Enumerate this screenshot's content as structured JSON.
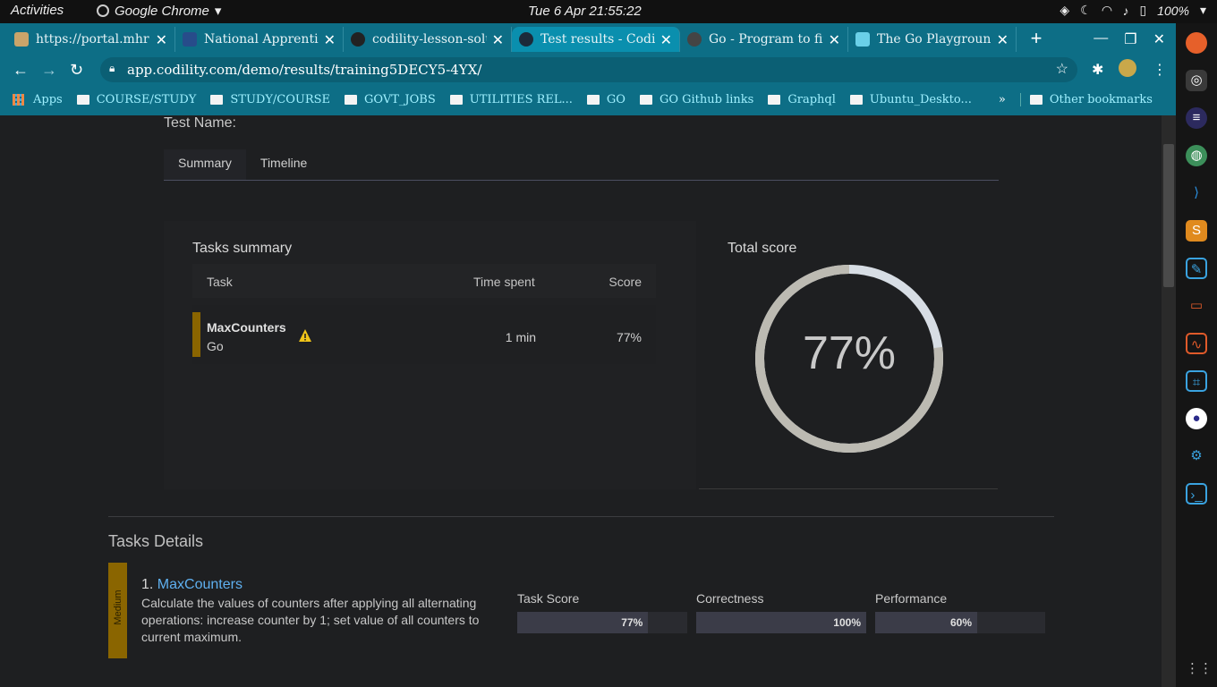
{
  "system": {
    "activities": "Activities",
    "app_name": "Google Chrome",
    "clock": "Tue 6 Apr  21:55:22",
    "battery": "100%"
  },
  "tabs": [
    {
      "title": "https://portal.mhr",
      "favicon_color": "#c9a46a",
      "active": false
    },
    {
      "title": "National Apprentic",
      "favicon_color": "#274c8a",
      "active": false
    },
    {
      "title": "codility-lesson-solu",
      "favicon_color": "#222222",
      "active": false
    },
    {
      "title": "Test results - Codil",
      "favicon_color": "#1c2a3a",
      "active": true
    },
    {
      "title": "Go - Program to fin",
      "favicon_color": "#444444",
      "active": false
    },
    {
      "title": "The Go Playground",
      "favicon_color": "#6ad0e8",
      "active": false
    }
  ],
  "address": {
    "url": "app.codility.com/demo/results/training5DECY5-4YX/"
  },
  "bookmarks": {
    "apps": "Apps",
    "items": [
      "COURSE/STUDY",
      "STUDY/COURSE",
      "GOVT_JOBS",
      "UTILITIES REL...",
      "GO",
      "GO Github links",
      "Graphql",
      "Ubuntu_Deskto..."
    ],
    "overflow": "»",
    "other": "Other bookmarks"
  },
  "page": {
    "test_name_label": "Test Name:",
    "tabs": [
      "Summary",
      "Timeline"
    ],
    "tasks_summary": {
      "heading": "Tasks summary",
      "columns": [
        "Task",
        "Time spent",
        "Score"
      ],
      "rows": [
        {
          "task": "MaxCounters",
          "language": "Go",
          "time": "1 min",
          "score": "77%"
        }
      ]
    },
    "total_score": {
      "heading": "Total score",
      "value": "77%",
      "fraction": 0.77
    },
    "tasks_details": {
      "heading": "Tasks Details",
      "task": {
        "level": "Medium",
        "number": "1.",
        "name": "MaxCounters",
        "description": "Calculate the values of counters after applying all alternating operations: increase counter by 1; set value of all counters to current maximum.",
        "metrics": [
          {
            "label": "Task Score",
            "value": "77%",
            "fraction": 0.77
          },
          {
            "label": "Correctness",
            "value": "100%",
            "fraction": 1.0
          },
          {
            "label": "Performance",
            "value": "60%",
            "fraction": 0.6
          }
        ]
      }
    }
  },
  "colors": {
    "chrome": "#0d6e86",
    "accent_link": "#5fb0f0",
    "medium": "#8a6500"
  }
}
